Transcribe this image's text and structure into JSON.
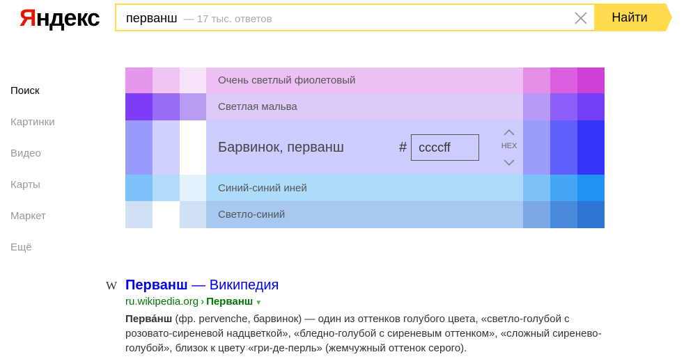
{
  "header": {
    "logo_first": "Я",
    "logo_rest": "ндекс",
    "query": "перванш",
    "hint": "— 17 тыс. ответов",
    "search_button": "Найти",
    "accent": "#ffdb4d"
  },
  "sidenav": {
    "items": [
      "Поиск",
      "Картинки",
      "Видео",
      "Карты",
      "Маркет",
      "Ещё"
    ]
  },
  "palette": {
    "rows": [
      {
        "name": "Очень светлый фиолетовый",
        "bg": "#ecc0f4",
        "left": [
          "#e596ed",
          "#f1c4f4",
          "#f8e4fa"
        ],
        "right": [
          "#e38fe8",
          "#db5fe0",
          "#cf40d8"
        ]
      },
      {
        "name": "Светлая мальва",
        "bg": "#dccbfa",
        "left": [
          "#7d3cf5",
          "#9a6cf5",
          "#b89cf3"
        ],
        "right": [
          "#b59af6",
          "#8e5ef8",
          "#7540f5"
        ]
      },
      {
        "name": "Барвинок, перванш",
        "bg": "#ccccfe",
        "left": [
          "#9a9afc",
          "#d0d0fc",
          "#ffffff"
        ],
        "right": [
          "#9c9cfc",
          "#5f5ffc",
          "#3434fa"
        ]
      },
      {
        "name": "Синий-синий иней",
        "bg": "#afdbfb",
        "left": [
          "#7cc1f9",
          "#b3dcfb",
          "#e3f2fd"
        ],
        "right": [
          "#7ec2f8",
          "#45a6f6",
          "#1f92f3"
        ]
      },
      {
        "name": "Светло-синий",
        "bg": "#a7c8ef",
        "left": [
          "#cfe0f4",
          "#ffffff",
          "#cfe0f4"
        ],
        "right": [
          "#7aa8e4",
          "#4a8adb",
          "#2f75d3"
        ]
      }
    ],
    "hex_value": "ccccff",
    "hash": "#",
    "hex_label": "HEX"
  },
  "result": {
    "wiki_icon": "W",
    "title_bold": "Перванш",
    "title_rest": " — Википедия",
    "url_domain": "ru.wikipedia.org",
    "url_sep": "›",
    "url_crumb": "Перванш",
    "snippet_bold": "Перва́нш",
    "snippet_rest": " (фр. pervenche, барвинок) — один из оттенков голубого цвета, «светло-голубой с розовато-сиреневой надцветкой», «бледно-голубой с сиреневым оттенком», «сложный сиренево-голубой», близок к цвету «гри-де-перль» (жемчужный оттенок серого)."
  }
}
